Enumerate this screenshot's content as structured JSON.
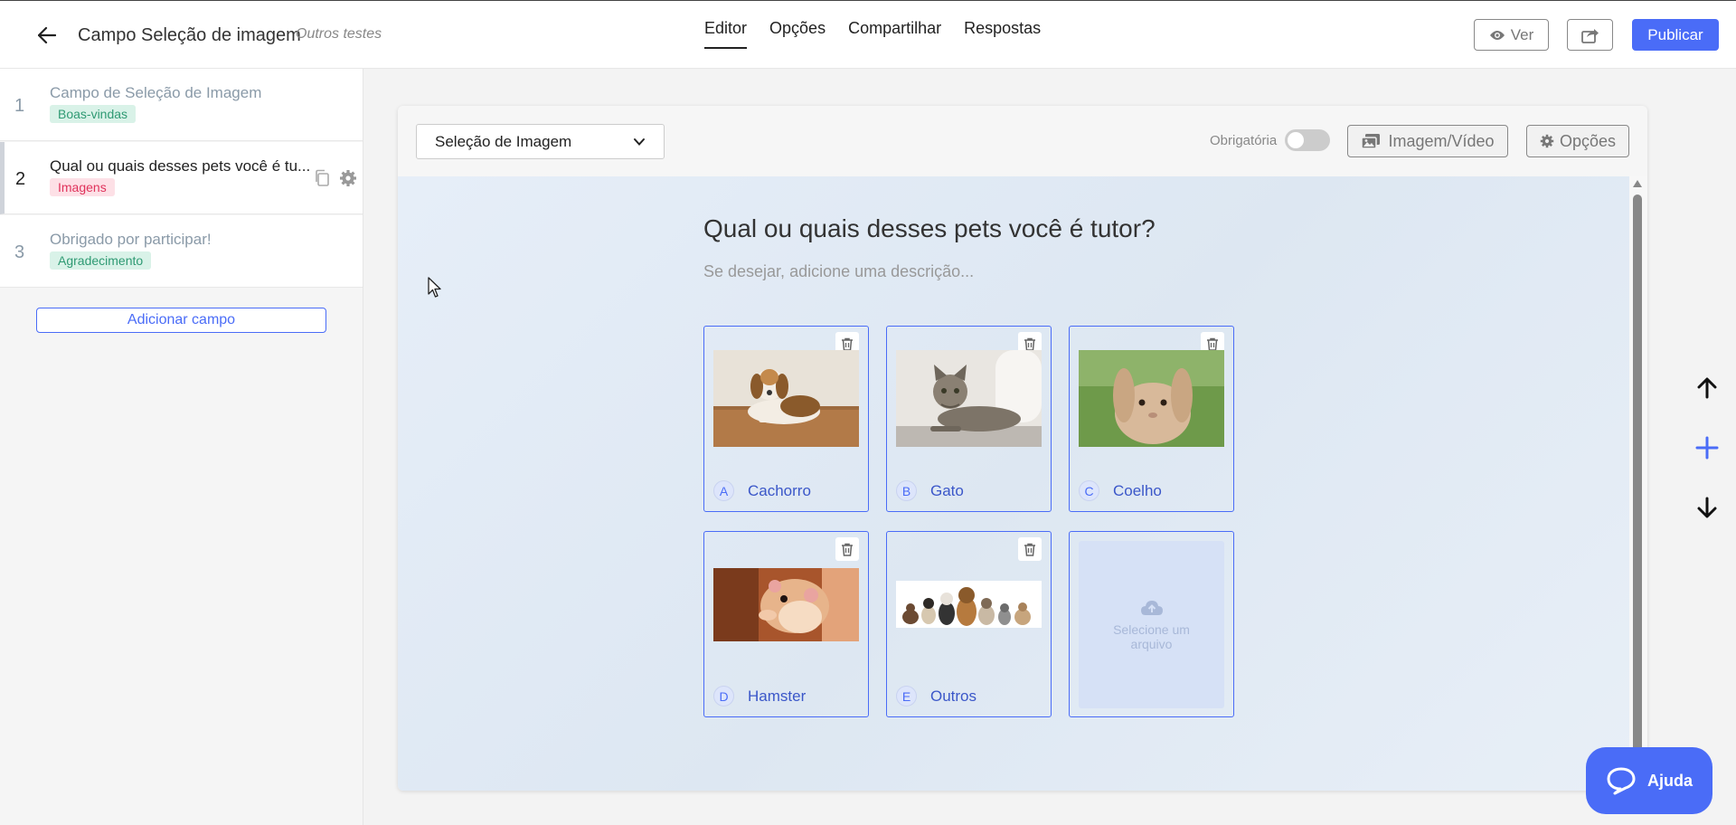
{
  "header": {
    "form_title": "Campo Seleção de imagem",
    "form_subtitle": "Outros testes",
    "tabs": [
      {
        "label": "Editor",
        "active": true
      },
      {
        "label": "Opções",
        "active": false
      },
      {
        "label": "Compartilhar",
        "active": false
      },
      {
        "label": "Respostas",
        "active": false
      }
    ],
    "view_label": "Ver",
    "publish_label": "Publicar",
    "accent_color": "#4a6cf7"
  },
  "sidebar": {
    "items": [
      {
        "number": "1",
        "title": "Campo de Seleção de Imagem",
        "badge": "Boas-vindas",
        "badge_color": "green",
        "active": false
      },
      {
        "number": "2",
        "title": "Qual ou quais desses pets você é tu...",
        "badge": "Imagens",
        "badge_color": "pink",
        "active": true
      },
      {
        "number": "3",
        "title": "Obrigado por participar!",
        "badge": "Agradecimento",
        "badge_color": "green",
        "active": false
      }
    ],
    "add_field_label": "Adicionar campo"
  },
  "toolbar": {
    "field_type": "Seleção de Imagem",
    "required_label": "Obrigatória",
    "required_on": false,
    "media_label": "Imagem/Vídeo",
    "options_label": "Opções"
  },
  "question": {
    "title": "Qual ou quais desses pets você é tutor?",
    "description_placeholder": "Se desejar, adicione uma descrição..."
  },
  "choices": [
    {
      "letter": "A",
      "label": "Cachorro"
    },
    {
      "letter": "B",
      "label": "Gato"
    },
    {
      "letter": "C",
      "label": "Coelho"
    },
    {
      "letter": "D",
      "label": "Hamster"
    },
    {
      "letter": "E",
      "label": "Outros"
    }
  ],
  "upload": {
    "label": "Selecione um arquivo"
  },
  "help": {
    "label": "Ajuda"
  }
}
